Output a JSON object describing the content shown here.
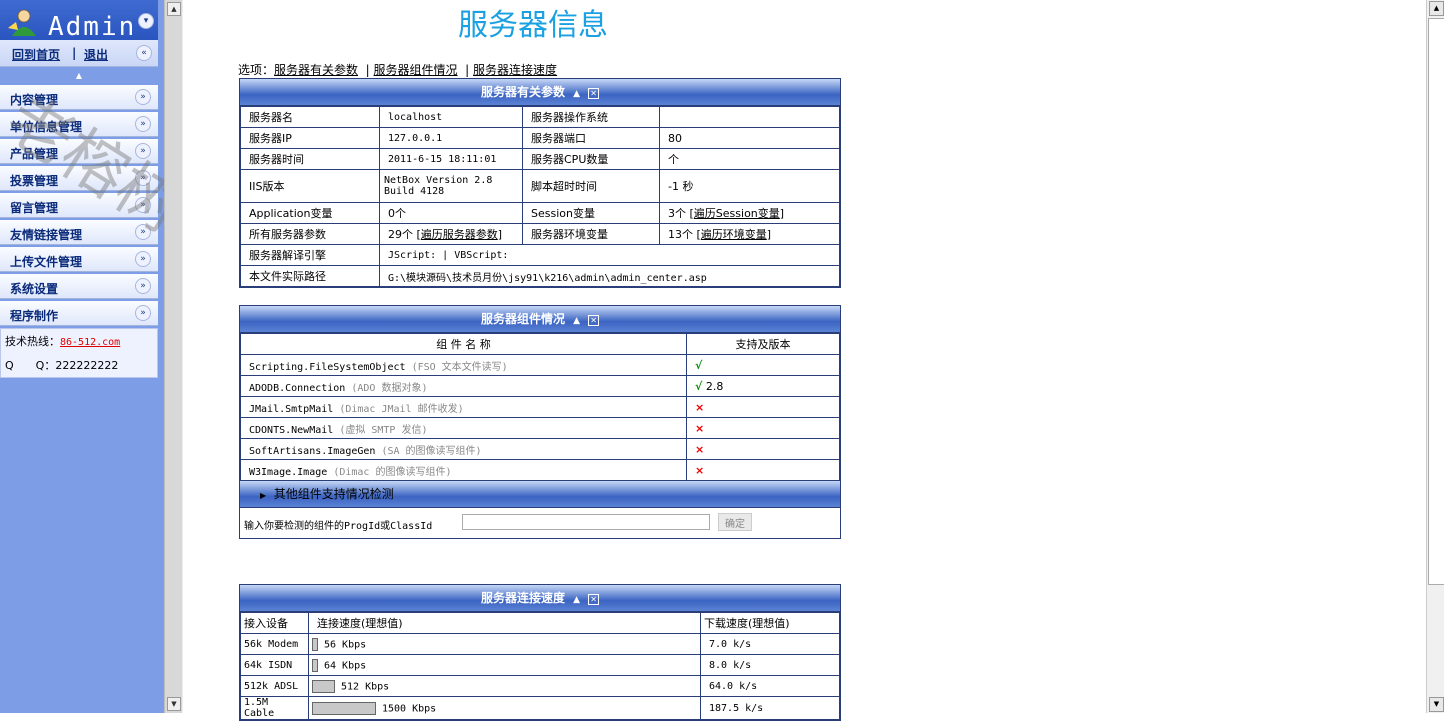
{
  "left": {
    "logo_text": "Admin",
    "home_link": "回到首页",
    "logout_link": "退出",
    "menu": [
      {
        "label": "内容管理"
      },
      {
        "label": "单位信息管理"
      },
      {
        "label": "产品管理"
      },
      {
        "label": "投票管理"
      },
      {
        "label": "留言管理"
      },
      {
        "label": "友情链接管理"
      },
      {
        "label": "上传文件管理"
      },
      {
        "label": "系统设置"
      },
      {
        "label": "程序制作"
      }
    ],
    "hotline_label": "技术热线：",
    "hotline_value": "86-512.com",
    "qq_label": "Q　　Q：",
    "qq_value": "222222222"
  },
  "watermark": "老榕树网络",
  "main": {
    "title": "服务器信息",
    "options_label": "选项：",
    "options": [
      "服务器有关参数",
      "服务器组件情况",
      "服务器连接速度"
    ],
    "params": {
      "heading": "服务器有关参数",
      "rows": [
        {
          "k1": "服务器名",
          "v1": "localhost",
          "k2": "服务器操作系统",
          "v2": ""
        },
        {
          "k1": "服务器IP",
          "v1": "127.0.0.1",
          "k2": "服务器端口",
          "v2": "80"
        },
        {
          "k1": "服务器时间",
          "v1": "2011-6-15 18:11:01",
          "k2": "服务器CPU数量",
          "v2": " 个"
        },
        {
          "k1": "IIS版本",
          "v1": "NetBox Version 2.8 Build 4128",
          "k2": "脚本超时时间",
          "v2": "-1 秒"
        },
        {
          "k1": "Application变量",
          "v1": "0个",
          "k2": "Session变量",
          "v2a": "3个 [",
          "v2b": "遍历Session变量",
          "v2c": "]"
        },
        {
          "k1": "所有服务器参数",
          "v1a": "29个 [",
          "v1b": "遍历服务器参数",
          "v1c": "]",
          "k2": "服务器环境变量",
          "v2a": "13个 [",
          "v2b": "遍历环境变量",
          "v2c": "]"
        }
      ],
      "engine_label": "服务器解译引擎",
      "engine_value": "JScript: | VBScript:",
      "path_label": "本文件实际路径",
      "path_value": "G:\\模块源码\\技术员月份\\jsy91\\k216\\admin\\admin_center.asp"
    },
    "components": {
      "heading": "服务器组件情况",
      "col1": "组 件 名 称",
      "col2": "支持及版本",
      "rows": [
        {
          "name": "Scripting.FileSystemObject",
          "desc": "(FSO 文本文件读写)",
          "status": "√",
          "ok": true,
          "ver": ""
        },
        {
          "name": "ADODB.Connection",
          "desc": "(ADO 数据对象)",
          "status": "√",
          "ok": true,
          "ver": "2.8"
        },
        {
          "name": "JMail.SmtpMail",
          "desc": "(Dimac JMail 邮件收发)",
          "status": "×",
          "ok": false,
          "ver": ""
        },
        {
          "name": "CDONTS.NewMail",
          "desc": "(虚拟 SMTP 发信)",
          "status": "×",
          "ok": false,
          "ver": ""
        },
        {
          "name": "SoftArtisans.ImageGen",
          "desc": "(SA 的图像读写组件)",
          "status": "×",
          "ok": false,
          "ver": ""
        },
        {
          "name": "W3Image.Image",
          "desc": "(Dimac 的图像读写组件)",
          "status": "×",
          "ok": false,
          "ver": ""
        }
      ],
      "other_heading": "其他组件支持情况检测",
      "check_label": "输入你要检测的组件的ProgId或ClassId",
      "check_button": "确定",
      "check_input_value": ""
    },
    "speed": {
      "heading": "服务器连接速度",
      "col1": "接入设备",
      "col2": "连接速度(理想值)",
      "col3": "下载速度(理想值)",
      "rows": [
        {
          "device": "56k Modem",
          "speed": "56 Kbps",
          "kbps": 56,
          "download": "7.0 k/s"
        },
        {
          "device": "64k ISDN",
          "speed": "64 Kbps",
          "kbps": 64,
          "download": "8.0 k/s"
        },
        {
          "device": "512k ADSL",
          "speed": "512 Kbps",
          "kbps": 512,
          "download": "64.0 k/s"
        },
        {
          "device": "1.5M Cable",
          "speed": "1500 Kbps",
          "kbps": 1500,
          "download": "187.5 k/s"
        }
      ]
    }
  },
  "colors": {
    "title": "#1ba1e2",
    "header_blue": "#3b64c2",
    "left_bg": "#7d9ee6",
    "ok": "#0a8a0a",
    "bad": "#e00000"
  }
}
